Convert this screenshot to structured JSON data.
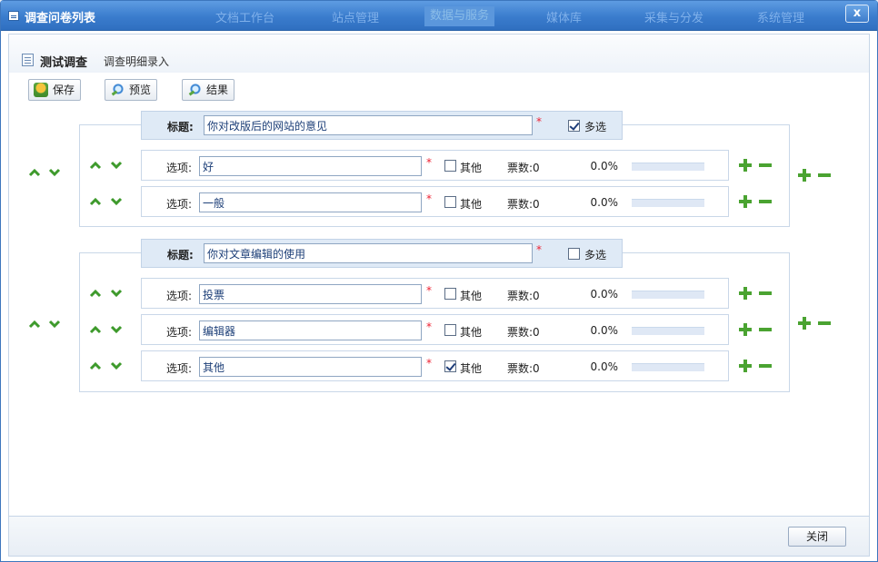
{
  "window": {
    "title": "调查问卷列表",
    "bg_menu": [
      "文档工作台",
      "站点管理",
      "数据与服务",
      "媒体库",
      "采集与分发",
      "系统管理"
    ],
    "close_glyph": "x"
  },
  "header": {
    "title": "测试调查",
    "subtitle": "调查明细录入"
  },
  "toolbar": {
    "save_label": "保存",
    "preview_label": "预览",
    "result_label": "结果"
  },
  "labels": {
    "title_label": "标题:",
    "option_label": "选项:",
    "multi_label": "多选",
    "other_label": "其他",
    "votes_prefix": "票数:",
    "required_mark": "*"
  },
  "questions": [
    {
      "title": "你对改版后的网站的意见",
      "multi": true,
      "options": [
        {
          "text": "好",
          "other": false,
          "votes": "0",
          "percent": "0.0%",
          "fraction": 0
        },
        {
          "text": "一般",
          "other": false,
          "votes": "0",
          "percent": "0.0%",
          "fraction": 0
        }
      ]
    },
    {
      "title": "你对文章编辑的使用",
      "multi": false,
      "options": [
        {
          "text": "投票",
          "other": false,
          "votes": "0",
          "percent": "0.0%",
          "fraction": 0
        },
        {
          "text": "编辑器",
          "other": false,
          "votes": "0",
          "percent": "0.0%",
          "fraction": 0
        },
        {
          "text": "其他",
          "other": true,
          "votes": "0",
          "percent": "0.0%",
          "fraction": 0
        }
      ]
    }
  ],
  "footer": {
    "close_label": "关闭"
  },
  "colors": {
    "accent": "#3a7ccd",
    "arrow_green": "#3e9a2c",
    "required_red": "#e22233"
  }
}
